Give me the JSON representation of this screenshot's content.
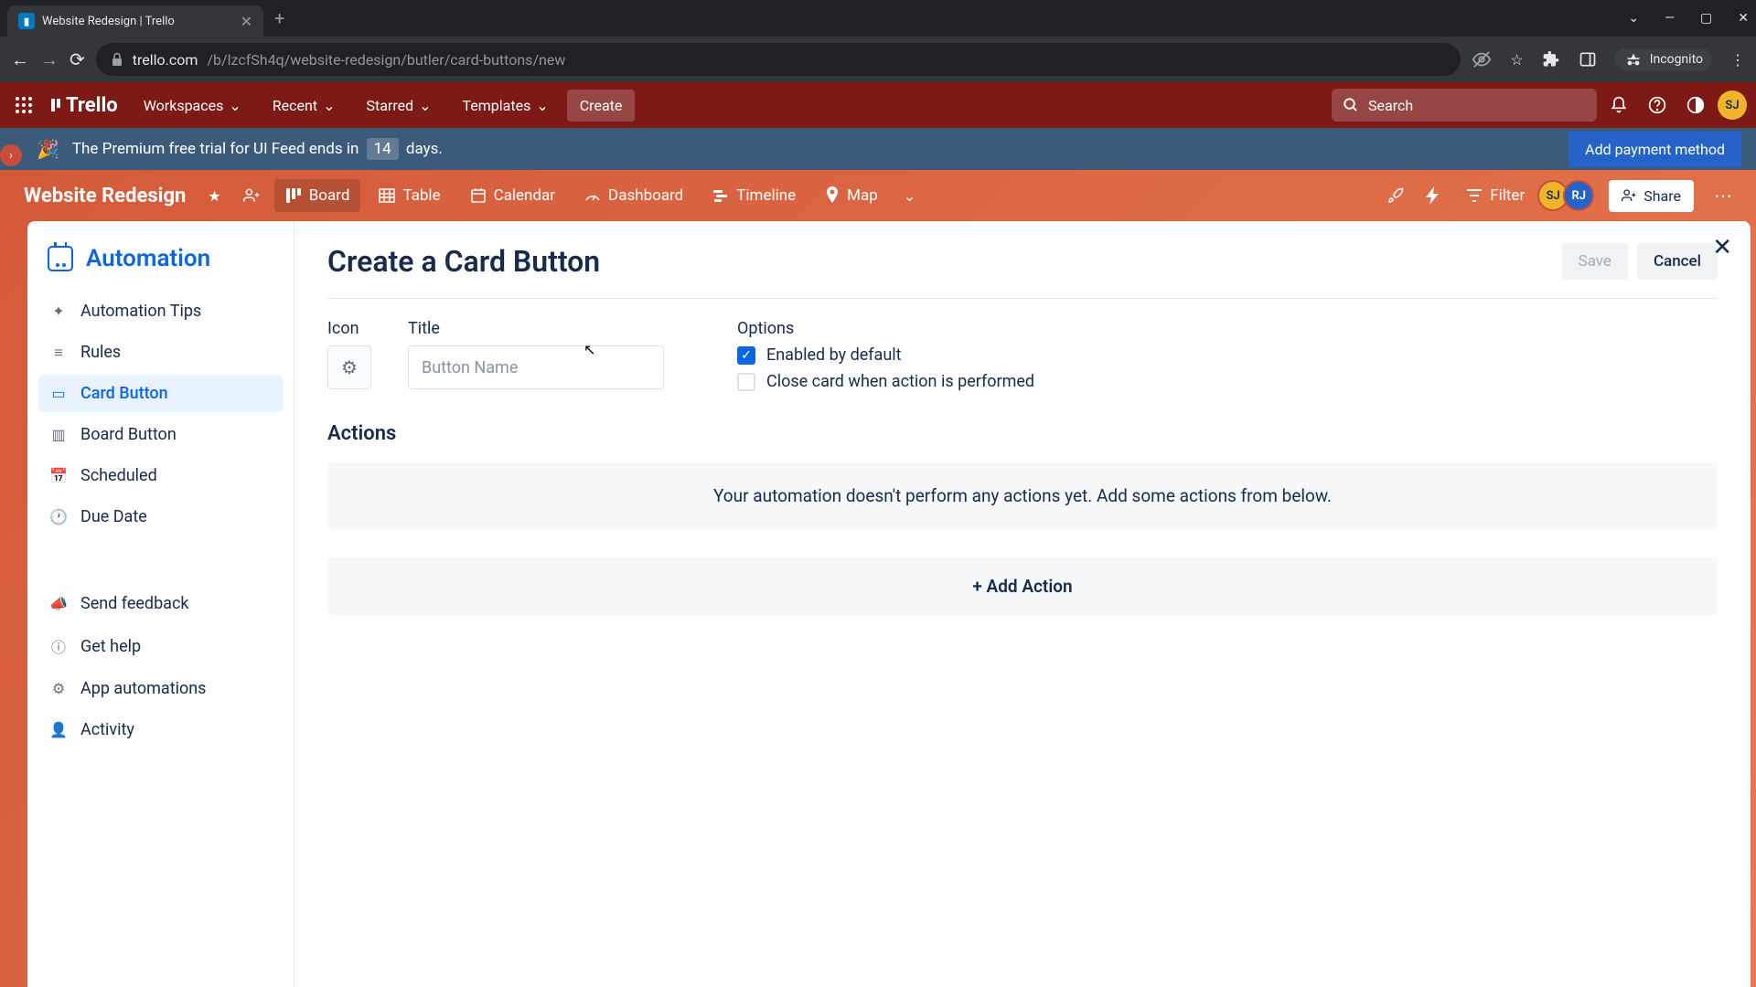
{
  "browser": {
    "tab_title": "Website Redesign | Trello",
    "url_domain": "trello.com",
    "url_path": "/b/lzcfSh4q/website-redesign/butler/card-buttons/new",
    "incognito_label": "Incognito"
  },
  "trello_header": {
    "logo": "Trello",
    "menus": {
      "workspaces": "Workspaces",
      "recent": "Recent",
      "starred": "Starred",
      "templates": "Templates"
    },
    "create": "Create",
    "search_placeholder": "Search",
    "avatar_initials": "SJ"
  },
  "banner": {
    "text_prefix": "The Premium free trial for UI Feed ends in",
    "days": "14",
    "text_suffix": "days.",
    "cta": "Add payment method"
  },
  "board": {
    "title": "Website Redesign",
    "views": {
      "board": "Board",
      "table": "Table",
      "calendar": "Calendar",
      "dashboard": "Dashboard",
      "timeline": "Timeline",
      "map": "Map"
    },
    "filter": "Filter",
    "members": [
      "SJ",
      "RJ"
    ],
    "share": "Share"
  },
  "automation": {
    "title": "Automation",
    "sidebar": {
      "tips": "Automation Tips",
      "rules": "Rules",
      "card_button": "Card Button",
      "board_button": "Board Button",
      "scheduled": "Scheduled",
      "due_date": "Due Date",
      "send_feedback": "Send feedback",
      "get_help": "Get help",
      "app_automations": "App automations",
      "activity": "Activity"
    },
    "main": {
      "title": "Create a Card Button",
      "save": "Save",
      "cancel": "Cancel",
      "icon_label": "Icon",
      "title_label": "Title",
      "title_placeholder": "Button Name",
      "options_label": "Options",
      "option_enabled": "Enabled by default",
      "option_close_card": "Close card when action is performed",
      "actions_label": "Actions",
      "actions_empty": "Your automation doesn't perform any actions yet. Add some actions from below.",
      "add_action": "+ Add Action"
    }
  }
}
